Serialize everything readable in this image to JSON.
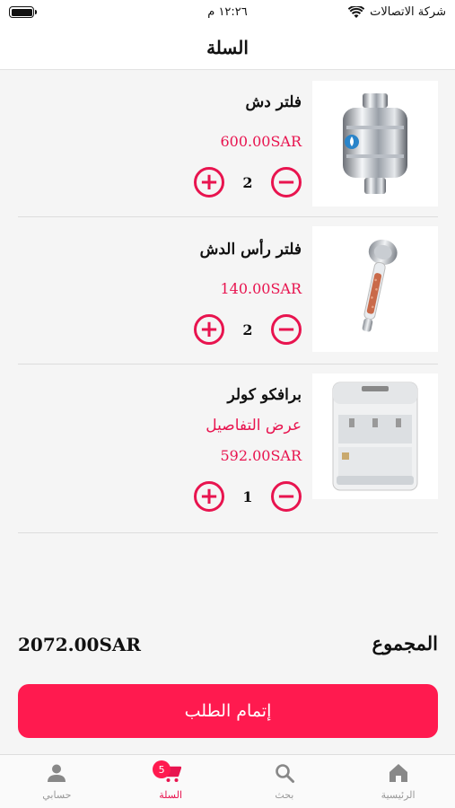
{
  "status_bar": {
    "carrier": "شركة الاتصالات",
    "time": "١٢:٢٦ م"
  },
  "header": {
    "title": "السلة"
  },
  "cart": {
    "items": [
      {
        "name": "فلتر دش",
        "price": "600.00SAR",
        "quantity": "2",
        "image": "shower-filter"
      },
      {
        "name": "فلتر رأس الدش",
        "price": "140.00SAR",
        "quantity": "2",
        "image": "shower-head"
      },
      {
        "name": "برافكو كولر",
        "details_link": "عرض التفاصيل",
        "price": "592.00SAR",
        "quantity": "1",
        "image": "water-cooler"
      }
    ]
  },
  "total": {
    "label": "المجموع",
    "amount": "2072.00SAR"
  },
  "checkout_label": "إتمام الطلب",
  "tab_bar": {
    "items": [
      {
        "label": "حسابي",
        "icon": "person-icon"
      },
      {
        "label": "السلة",
        "icon": "cart-icon",
        "badge": "5",
        "active": true
      },
      {
        "label": "بحث",
        "icon": "search-icon"
      },
      {
        "label": "الرئيسية",
        "icon": "home-icon"
      }
    ]
  },
  "colors": {
    "accent": "#e8144f",
    "button": "#ff1a4f"
  }
}
